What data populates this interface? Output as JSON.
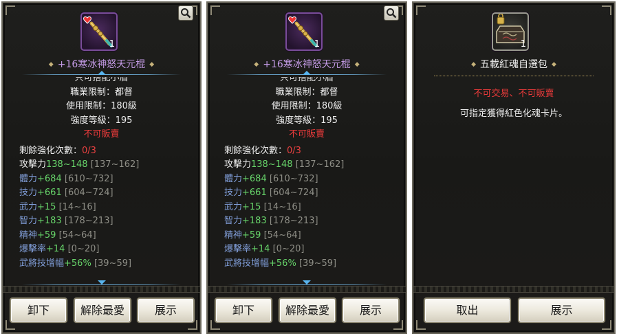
{
  "panels": [
    {
      "item_name": "+16寒冰神怒天元棍",
      "quantity": "1",
      "icon": "staff-icon",
      "clipped_line": "只可搭配小眉",
      "info_lines": [
        "職業限制：都督",
        "使用限制：180級",
        "強度等級：195"
      ],
      "untradeable": "不可販賣",
      "enhance": {
        "label": "剩餘強化次數：",
        "value": "0/3"
      },
      "stats": [
        {
          "name": "攻擊力",
          "value": "138~148",
          "range": "[137~162]",
          "name_color": "white"
        },
        {
          "name": "體力",
          "value": "+684",
          "range": "[610~732]",
          "name_color": "blue"
        },
        {
          "name": "技力",
          "value": "+661",
          "range": "[604~724]",
          "name_color": "blue"
        },
        {
          "name": "武力",
          "value": "+15",
          "range": "[14~16]",
          "name_color": "blue"
        },
        {
          "name": "智力",
          "value": "+183",
          "range": "[178~213]",
          "name_color": "blue"
        },
        {
          "name": "精神",
          "value": "+59",
          "range": "[54~64]",
          "name_color": "blue"
        },
        {
          "name": "爆擊率",
          "value": "+14",
          "range": "[0~20]",
          "name_color": "blue"
        },
        {
          "name": "武將技增幅",
          "value": "+56%",
          "range": "[39~59]",
          "name_color": "blue"
        }
      ],
      "buttons": [
        "卸下",
        "解除最愛",
        "展示"
      ]
    },
    {
      "item_name": "+16寒冰神怒天元棍",
      "quantity": "1",
      "icon": "staff-icon",
      "clipped_line": "只可搭配小眉",
      "info_lines": [
        "職業限制：都督",
        "使用限制：180級",
        "強度等級：195"
      ],
      "untradeable": "不可販賣",
      "enhance": {
        "label": "剩餘強化次數：",
        "value": "0/3"
      },
      "stats": [
        {
          "name": "攻擊力",
          "value": "138~148",
          "range": "[137~162]",
          "name_color": "white"
        },
        {
          "name": "體力",
          "value": "+684",
          "range": "[610~732]",
          "name_color": "blue"
        },
        {
          "name": "技力",
          "value": "+661",
          "range": "[604~724]",
          "name_color": "blue"
        },
        {
          "name": "武力",
          "value": "+15",
          "range": "[14~16]",
          "name_color": "blue"
        },
        {
          "name": "智力",
          "value": "+183",
          "range": "[178~213]",
          "name_color": "blue"
        },
        {
          "name": "精神",
          "value": "+59",
          "range": "[54~64]",
          "name_color": "blue"
        },
        {
          "name": "爆擊率",
          "value": "+14",
          "range": "[0~20]",
          "name_color": "blue"
        },
        {
          "name": "武將技增幅",
          "value": "+56%",
          "range": "[39~59]",
          "name_color": "blue"
        }
      ],
      "buttons": [
        "卸下",
        "解除最愛",
        "展示"
      ]
    },
    {
      "item_name": "五載紅魂自選包",
      "quantity": "1",
      "icon": "locked-chest-icon",
      "restriction": "不可交易、不可販賣",
      "description": "可指定獲得紅色化魂卡片。",
      "buttons": [
        "取出",
        "展示"
      ]
    }
  ],
  "colors": {
    "item_name_purple": "#c49be6",
    "stat_green": "#67d46a",
    "stat_blue": "#7f9cd6",
    "warning_red": "#e83a3a",
    "panel_bg": "#1c1b19"
  }
}
